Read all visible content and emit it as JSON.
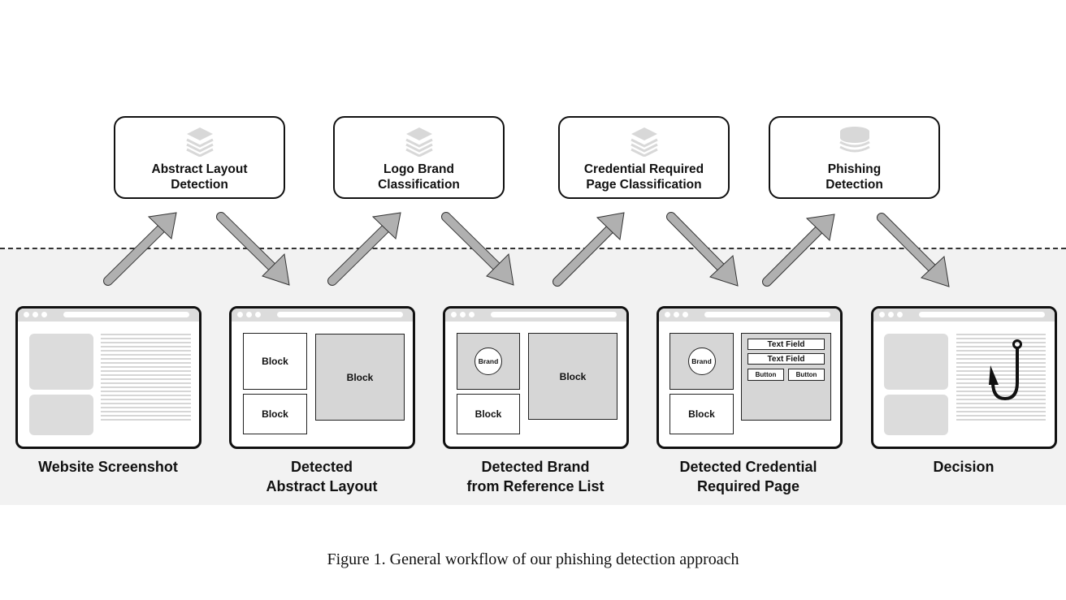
{
  "diagram": {
    "models": [
      {
        "label": "Abstract Layout\nDetection",
        "icon": "layers-stack-icon"
      },
      {
        "label": "Logo Brand\nClassification",
        "icon": "layers-stack-icon"
      },
      {
        "label": "Credential Required\nPage Classification",
        "icon": "layers-stack-icon"
      },
      {
        "label": "Phishing\nDetection",
        "icon": "database-icon"
      }
    ],
    "stages": [
      {
        "label": "Website Screenshot"
      },
      {
        "label": "Detected\nAbstract Layout",
        "blocks": [
          "Block",
          "Block",
          "Block"
        ]
      },
      {
        "label": "Detected Brand\nfrom Reference List",
        "brand": "Brand",
        "blocks": [
          "Block",
          "Block"
        ]
      },
      {
        "label": "Detected Credential\nRequired Page",
        "brand": "Brand",
        "block": "Block",
        "text_fields": [
          "Text Field",
          "Text Field"
        ],
        "buttons": [
          "Button",
          "Button"
        ]
      },
      {
        "label": "Decision",
        "icon": "fishhook-icon"
      }
    ],
    "caption": "Figure 1. General workflow of our phishing detection approach",
    "colors": {
      "band": "#f2f2f2",
      "arrow": "#b0b0b0",
      "placeholder": "#dcdcdc",
      "stroke": "#111111"
    }
  }
}
